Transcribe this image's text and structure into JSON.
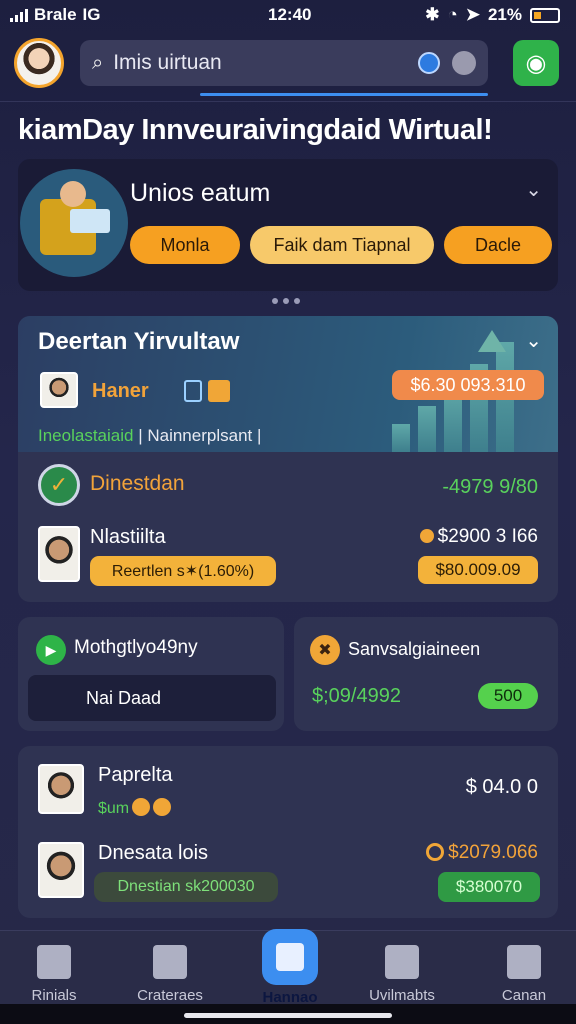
{
  "status": {
    "carrier": "Brale",
    "net": "IG",
    "time": "12:40",
    "battery": "21%"
  },
  "header": {
    "search_value": "Imis uirtuan"
  },
  "headline": "kiamDay Innveuraivingdaid Wirtual!",
  "promo": {
    "title": "Unios eatum",
    "buttons": [
      "Monla",
      "Faik dam Tiapnal",
      "Dacle"
    ]
  },
  "portfolio": {
    "title": "Deertan Yirvultaw",
    "name": "Haner",
    "amount": "$6.30 093.310",
    "sub_green": "Ineolastaiaid",
    "sub_white": "Nainnerplsant",
    "row1_label": "Dinestdan",
    "row1_value": "-4979 9/80",
    "row2_label": "Nlastiilta",
    "row2_value": "$2900 3 I66",
    "row2_badge": "Reertlen s✶(1.60%)",
    "row2_badge_value": "$80.009.09"
  },
  "card_left": {
    "title": "Mothgtlyo49ny",
    "input": "Nai Daad"
  },
  "card_right": {
    "title": "Sanvsalgiaineen",
    "value": "$;09/4992",
    "pill": "500"
  },
  "list": {
    "item1_name": "Paprelta",
    "item1_sub": "$um",
    "item1_value": "$ 04.0 0",
    "item2_name": "Dnesata lois",
    "item2_badge": "Dnestian sk200030",
    "item2_value": "$2079.066",
    "item2_pill": "$380070"
  },
  "tabs": [
    "Rinials",
    "Crateraes",
    "Hannao",
    "Uvilmabts",
    "Canan"
  ],
  "colors": {
    "accent": "#3c8ef0",
    "orange": "#f6a021",
    "green": "#59d25c",
    "bg": "#1d1f3f"
  }
}
